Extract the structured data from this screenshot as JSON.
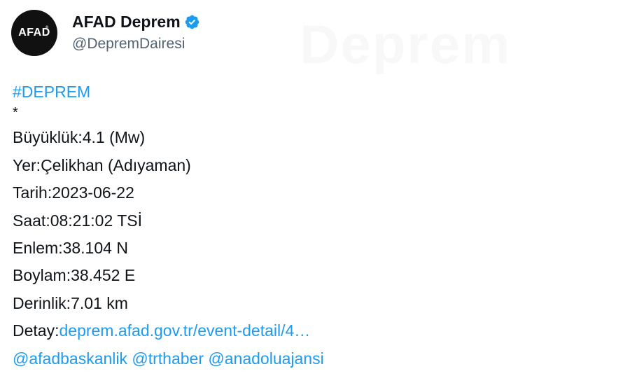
{
  "author": {
    "avatar_text": "AFAD",
    "avatar_mark": "®",
    "display_name": "AFAD Deprem",
    "handle": "@DepremDairesi",
    "verified_icon": "verified-badge-icon",
    "verified_color": "#1d9bf0"
  },
  "watermark_text": "Deprem",
  "tweet": {
    "hashtag": "#DEPREM",
    "separator": "*",
    "lines": [
      "Büyüklük:4.1 (Mw)",
      "Yer:Çelikhan (Adıyaman)",
      "Tarih:2023-06-22",
      "Saat:08:21:02 TSİ",
      "Enlem:38.104 N",
      "Boylam:38.452 E",
      "Derinlik:7.01 km"
    ],
    "detail_label": "Detay:",
    "detail_link": "deprem.afad.gov.tr/event-detail/4…",
    "mentions": [
      "@afadbaskanlik",
      "@trthaber",
      "@anadoluajansi"
    ]
  },
  "colors": {
    "link": "#1d9bf0",
    "text": "#0f1419",
    "muted": "#536471",
    "avatar_bg": "#111111"
  }
}
